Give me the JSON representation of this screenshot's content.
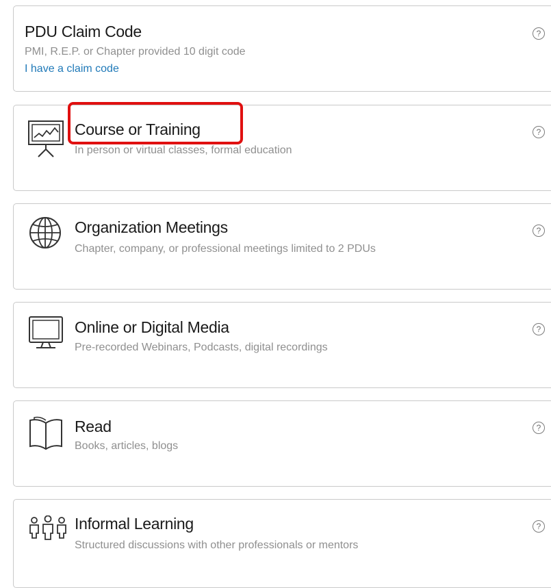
{
  "cards": [
    {
      "icon": "none",
      "title": "PDU Claim Code",
      "description": "PMI, R.E.P. or Chapter provided 10 digit code",
      "link": "I have a claim code",
      "help": "?"
    },
    {
      "icon": "presentation-board-icon",
      "title": "Course or Training",
      "description": "In person or virtual classes, formal education",
      "help": "?"
    },
    {
      "icon": "globe-icon",
      "title": "Organization Meetings",
      "description": "Chapter, company, or professional meetings limited to 2 PDUs",
      "help": "?"
    },
    {
      "icon": "monitor-icon",
      "title": "Online or Digital Media",
      "description": "Pre-recorded Webinars, Podcasts, digital recordings",
      "help": "?"
    },
    {
      "icon": "open-book-icon",
      "title": "Read",
      "description": "Books, articles, blogs",
      "help": "?"
    },
    {
      "icon": "people-group-icon",
      "title": "Informal Learning",
      "description": "Structured discussions with other professionals or mentors",
      "help": "?"
    }
  ],
  "highlight_color": "#e01010",
  "link_color": "#1f79b8"
}
